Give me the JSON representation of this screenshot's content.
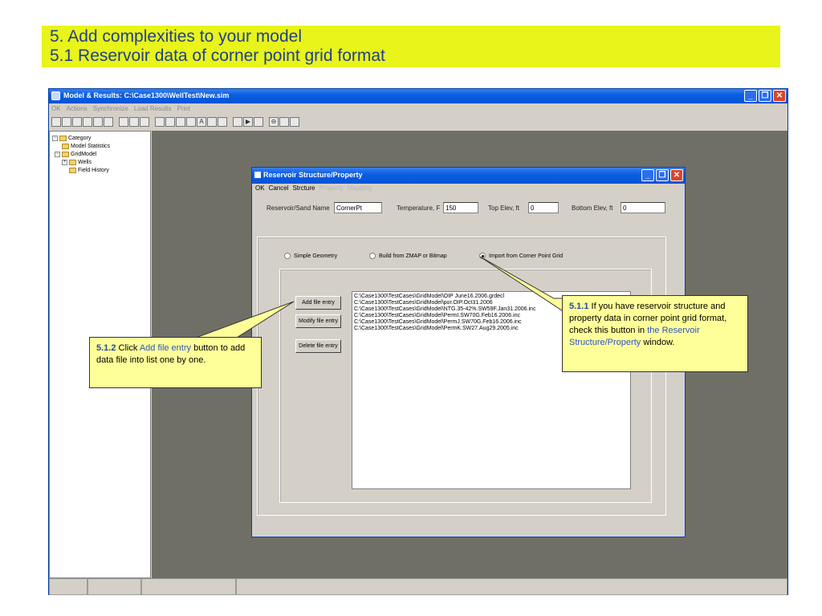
{
  "slide": {
    "title_line1": "5. Add complexities to your model",
    "title_line2": "5.1 Reservoir data of corner point grid format"
  },
  "main_window": {
    "title": "Model & Results:  C:\\Case1300\\WellTest\\New.sim",
    "menu": [
      "OK",
      "Actions",
      "Synchronize",
      "Load Results",
      "Print"
    ],
    "toolbar_icons": [
      "new-icon",
      "open-icon",
      "save-icon",
      "copy-icon",
      "paste-icon",
      "print-icon",
      "undo-icon",
      "redo-icon",
      "zoom-icon",
      "pan-icon",
      "pointer-icon",
      "rect-icon",
      "polygon-icon",
      "text-icon",
      "move-icon",
      "grid-icon",
      "well-icon",
      "play-icon",
      "stop-icon",
      "target-icon",
      "zoom-in-icon",
      "zoom-out-icon"
    ],
    "tree": {
      "root": "Category",
      "model_statistics": "Model Statistics",
      "gridmodel": "GridModel",
      "wells": "Wells",
      "field_history": "Field History"
    },
    "window_buttons": {
      "minimize": "_",
      "restore": "❐",
      "close": "✕"
    }
  },
  "dialog": {
    "title": "Reservoir Structure/Property",
    "menu": {
      "ok": "OK",
      "cancel": "Cancel",
      "structure": "Strcture",
      "property": "Property",
      "mapping": "Mapping"
    },
    "fields": {
      "name_label": "Reservoir/Sand Name",
      "name_value": "CornerPt",
      "temp_label": "Temperature, F",
      "temp_value": "150",
      "top_label": "Top Elev, ft",
      "top_value": "0",
      "bottom_label": "Bottom Elev, ft",
      "bottom_value": "0"
    },
    "radios": {
      "simple": "Simple Geometry",
      "zmap": "Build from ZMAP or Bitmap",
      "corner": "Import from Corner Point Grid",
      "selected": "corner"
    },
    "buttons": {
      "add": "Add file entry",
      "modify": "Modify file entry",
      "delete": "Delete file entry"
    },
    "files": [
      "C:\\Case1300\\TestCases\\GridModel\\OIP June16.2006.grdecl",
      "C:\\Case1300\\TestCases\\GridModel\\por.OIP.Oct31.2006",
      "C:\\Case1300\\TestCases\\GridModel\\NTG.35-42%.SW59F.Jan31.2006.inc",
      "C:\\Case1300\\TestCases\\GridModel\\PermI.SW70G.Feb16.2006.inc",
      "C:\\Case1300\\TestCases\\GridModel\\PermJ.SW70G.Feb16.2006.inc",
      "C:\\Case1300\\TestCases\\GridModel\\PermK.SW27.Aug29.2005.inc"
    ]
  },
  "callouts": {
    "c1": {
      "num": "5.1.1",
      "pre": " If you have reservoir structure and property data in corner point grid format, check this button in ",
      "link": "the Reservoir Structure/Property",
      "post": " window."
    },
    "c2": {
      "num": "5.1.2",
      "pre": " Click ",
      "link": "Add file entry",
      "post": " button to add data file into list one by one."
    }
  },
  "colors": {
    "title_bar": "#e8f41a",
    "title_text": "#1f3f8f",
    "callout_bg": "#ffff99",
    "workspace": "#706f66"
  }
}
